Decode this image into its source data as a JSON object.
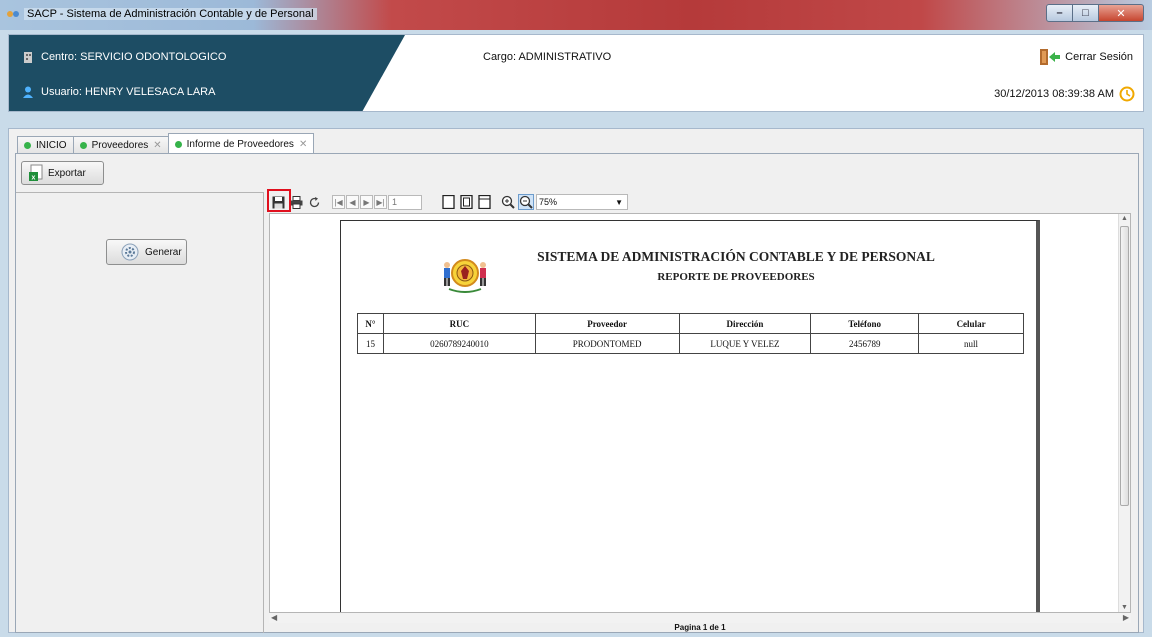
{
  "window": {
    "title": "SACP - Sistema de Administración Contable y de Personal"
  },
  "header": {
    "centro": "Centro: SERVICIO ODONTOLOGICO",
    "usuario": "Usuario: HENRY VELESACA LARA",
    "cargo": "Cargo:  ADMINISTRATIVO",
    "logout_label": "Cerrar Sesión",
    "datetime": "30/12/2013 08:39:38 AM"
  },
  "tabs": [
    {
      "label": "INICIO",
      "closable": false
    },
    {
      "label": "Proveedores",
      "closable": true
    },
    {
      "label": "Informe de Proveedores",
      "closable": true,
      "active": true
    }
  ],
  "actions": {
    "export_label": "Exportar",
    "generate_label": "Generar"
  },
  "viewer": {
    "page_number": "1",
    "zoom": "75%",
    "page_status": "Pagina 1 de 1"
  },
  "report": {
    "title": "SISTEMA DE ADMINISTRACIÓN CONTABLE Y DE PERSONAL",
    "subtitle": "REPORTE DE PROVEEDORES",
    "columns": [
      "N°",
      "RUC",
      "Proveedor",
      "Dirección",
      "Teléfono",
      "Celular"
    ],
    "rows": [
      [
        "15",
        "0260789240010",
        "PRODONTOMED",
        "LUQUE Y VELEZ",
        "2456789",
        "null"
      ]
    ]
  },
  "colors": {
    "header_dark": "#1d4d64",
    "tab_dot": "#36b34a",
    "highlight": "#e0101e"
  }
}
